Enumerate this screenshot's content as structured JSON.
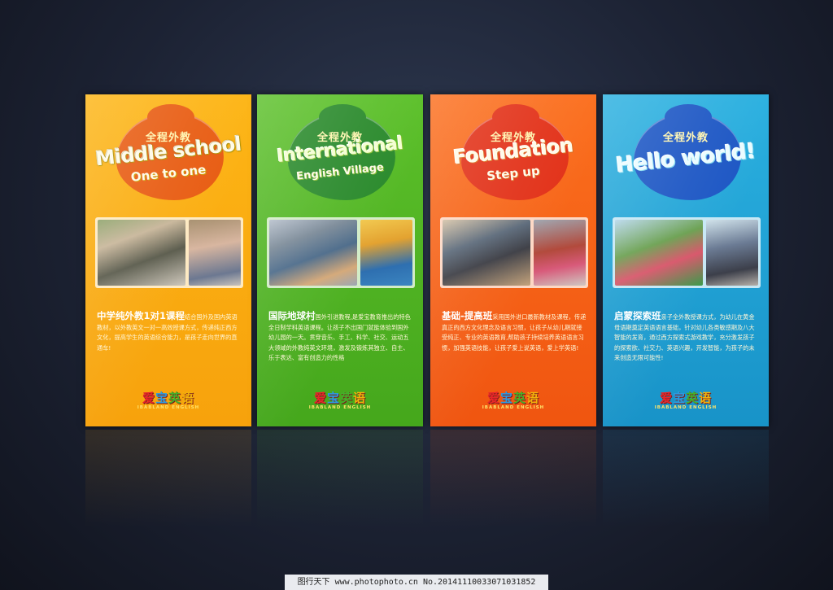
{
  "panels": [
    {
      "tag": "全程外教",
      "title": "Middle school",
      "subtitle": "One to one",
      "heading": "中学纯外教1对1课程",
      "body": "结合国外及国内英语教材，以外教英文一对一高效授课方式，传递纯正西方文化，提高学生的英语综合能力，是孩子走向世界的直通车!"
    },
    {
      "tag": "全程外教",
      "title": "International",
      "subtitle": "English Village",
      "heading": "国际地球村",
      "body": "国外引进教程,是爱宝教育推出的特色全日制学科英语课程。让孩子不出国门就能体验到国外幼儿园的一天。贯穿音乐、手工、科学、社交、运动五大领域的外教纯英文环境，激发及锻炼其独立、自主、乐于表达、富有创造力的性格"
    },
    {
      "tag": "全程外教",
      "title": "Foundation",
      "subtitle": "Step up",
      "heading": "基础-提高班",
      "body": "采用国外进口最新教材及课程，传递真正的西方文化理念及语言习惯，让孩子从幼儿期就接受纯正、专业的英语教育,帮助孩子持续培养英语语言习惯，加强英语技能，让孩子爱上说英语，爱上学英语!"
    },
    {
      "tag": "全程外教",
      "title": "Hello world!",
      "subtitle": "",
      "heading": "启蒙探索班",
      "body": "亲子全外教授课方式，为幼儿在黄金母语期奠定英语语言基础，针对幼儿各类敏感期及八大智能的发育，通过西方探索式游戏教学，充分激发孩子的探索欲、社交力、英语兴趣，开发智能，为孩子的未来创造无限可能性!"
    }
  ],
  "logo": {
    "chars": [
      "爱",
      "宝",
      "英",
      "语"
    ],
    "english": "IBABLAND ENGLISH"
  },
  "footer": {
    "text": "图行天下  www.photophoto.cn  No.20141110033071031852"
  }
}
